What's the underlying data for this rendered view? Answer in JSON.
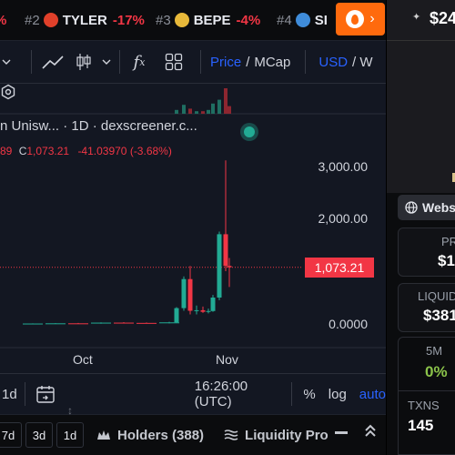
{
  "ticker": {
    "items": [
      {
        "rank": "#2",
        "name": "TYLER",
        "change": "-17%",
        "coin_color": "#e0402a"
      },
      {
        "rank": "#3",
        "name": "BEPE",
        "change": "-4%",
        "coin_color": "#e8b93a"
      },
      {
        "rank": "#4",
        "name": "SI",
        "change": "",
        "coin_color": "#3f8cd9"
      }
    ],
    "hot_icon": "flame-icon",
    "right_price": "$24"
  },
  "toolbar": {
    "price_label": "Price",
    "separator": "/",
    "mcap_label": "MCap",
    "currency_label": "USD",
    "currency_sep": "/ W"
  },
  "chart": {
    "title": "n Unisw... · 1D · dexscreener.c...",
    "ohlc_partial": "89",
    "ohlc_close_label": "C",
    "ohlc_close": "1,073.21",
    "ohlc_change": "-41.03970 (-3.68%)",
    "current_price": "1,073.21",
    "y_ticks": [
      "3,000.00",
      "2,000.00",
      "0.0000"
    ],
    "x_ticks": [
      "Oct",
      "Nov"
    ]
  },
  "chart_data": {
    "type": "candlestick",
    "ylim": [
      -150,
      3300
    ],
    "y_ticks": [
      3000,
      2000,
      0
    ],
    "current_price": 1073.21,
    "candles": [
      {
        "o": 5,
        "h": 10,
        "l": 0,
        "c": 8
      },
      {
        "o": 8,
        "h": 15,
        "l": 3,
        "c": 12
      },
      {
        "o": 12,
        "h": 20,
        "l": 8,
        "c": 10
      },
      {
        "o": 10,
        "h": 30,
        "l": 5,
        "c": 25
      },
      {
        "o": 25,
        "h": 35,
        "l": 15,
        "c": 20
      },
      {
        "o": 20,
        "h": 28,
        "l": 12,
        "c": 18
      },
      {
        "o": 18,
        "h": 40,
        "l": 10,
        "c": 30
      },
      {
        "o": 30,
        "h": 320,
        "l": 20,
        "c": 300
      },
      {
        "o": 300,
        "h": 900,
        "l": 250,
        "c": 850
      },
      {
        "o": 850,
        "h": 1100,
        "l": 180,
        "c": 250
      },
      {
        "o": 250,
        "h": 350,
        "l": 180,
        "c": 260
      },
      {
        "o": 260,
        "h": 330,
        "l": 210,
        "c": 230
      },
      {
        "o": 230,
        "h": 290,
        "l": 200,
        "c": 245
      },
      {
        "o": 245,
        "h": 550,
        "l": 230,
        "c": 500
      },
      {
        "o": 500,
        "h": 1750,
        "l": 450,
        "c": 1700
      },
      {
        "o": 1700,
        "h": 3100,
        "l": 1000,
        "c": 1100
      },
      {
        "o": 1100,
        "h": 1250,
        "l": 700,
        "c": 1073.21
      }
    ],
    "volume": [
      0,
      0,
      0,
      0,
      0,
      0,
      0,
      0.15,
      0.35,
      0.2,
      0.1,
      0.1,
      0.15,
      0.4,
      0.55,
      1.0,
      0.3
    ]
  },
  "bottom_bar": {
    "range_label": "1d",
    "time": "16:26:00 (UTC)",
    "percent_label": "%",
    "log_label": "log",
    "auto_label": "auto"
  },
  "tabs": {
    "timeframes": [
      "7d",
      "3d",
      "1d"
    ],
    "holders_label": "Holders (388)",
    "liquidity_label": "Liquidity Pro"
  },
  "right_panel": {
    "website_label": "Webs",
    "price_label": "PR",
    "price_value": "$1,",
    "liquidity_label": "LIQUID",
    "liquidity_value": "$381",
    "m5_label": "5M",
    "m5_value": "0%",
    "m5_color": "#8bc34a",
    "txns_label": "TXNS",
    "txns_value": "145"
  },
  "colors": {
    "up": "#22ab94",
    "down": "#f23645",
    "accent": "#2962ff",
    "hot": "#ff6a0d"
  }
}
